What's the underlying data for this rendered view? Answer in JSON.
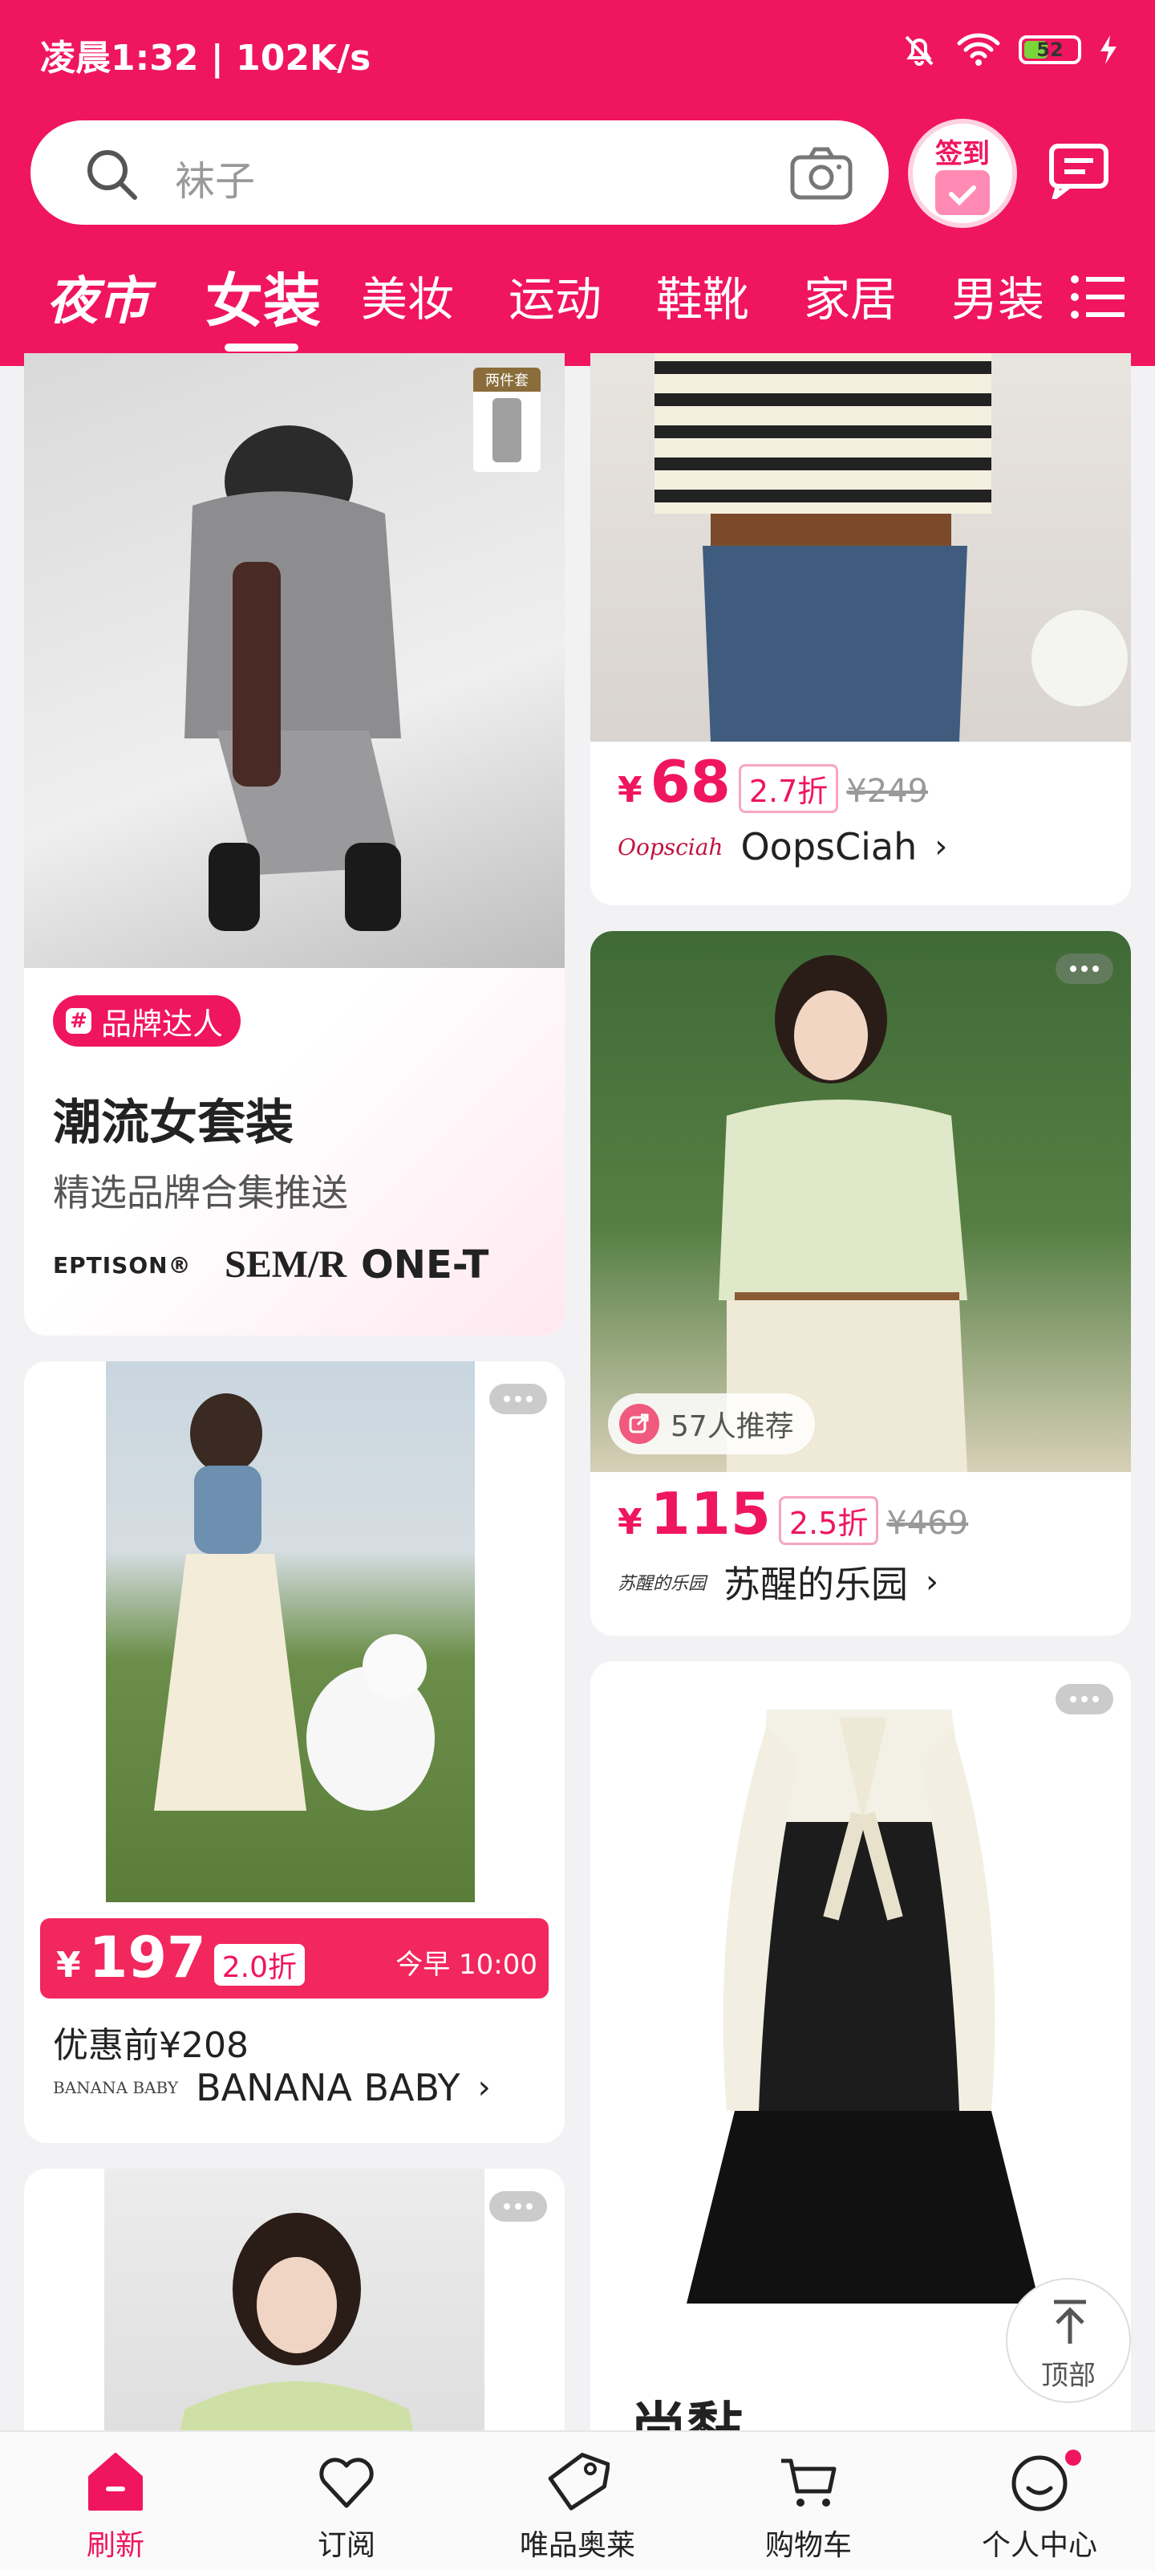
{
  "status_bar": {
    "time": "凌晨1:32 | 102K/s",
    "battery": "52"
  },
  "search": {
    "placeholder": "袜子"
  },
  "signin": {
    "label": "签到"
  },
  "tabs": {
    "night_market": "夜市",
    "items": [
      "女装",
      "美妆",
      "运动",
      "鞋靴",
      "家居",
      "男装"
    ],
    "active": "女装"
  },
  "cards": {
    "brand_promo": {
      "badge": "品牌达人",
      "title": "潮流女套装",
      "subtitle": "精选品牌合集推送",
      "brands": [
        "EPTISON®",
        "SEM/R",
        "ONE-T"
      ],
      "tag": "两件套"
    },
    "oopsciah": {
      "currency": "¥",
      "price": "68",
      "discount": "2.7折",
      "original": "¥249",
      "brand_logo": "Oopsciah",
      "brand": "OopsCiah"
    },
    "suxing": {
      "recommend": "57人推荐",
      "currency": "¥",
      "price": "115",
      "discount": "2.5折",
      "original": "¥469",
      "brand_logo": "苏醒的乐园",
      "brand": "苏醒的乐园"
    },
    "banana": {
      "currency": "¥",
      "price": "197",
      "discount": "2.0折",
      "time": "今早 10:00",
      "before_discount": "优惠前¥208",
      "brand_logo": "BANANA BABY",
      "brand": "BANANA BABY"
    },
    "dress": {
      "partial_title": "尚黏"
    }
  },
  "to_top": {
    "label": "顶部"
  },
  "bottom_nav": [
    {
      "label": "刷新"
    },
    {
      "label": "订阅"
    },
    {
      "label": "唯品奥莱"
    },
    {
      "label": "购物车"
    },
    {
      "label": "个人中心"
    }
  ],
  "colors": {
    "brand_pink": "#f0155f",
    "background": "#f2f2f4"
  }
}
